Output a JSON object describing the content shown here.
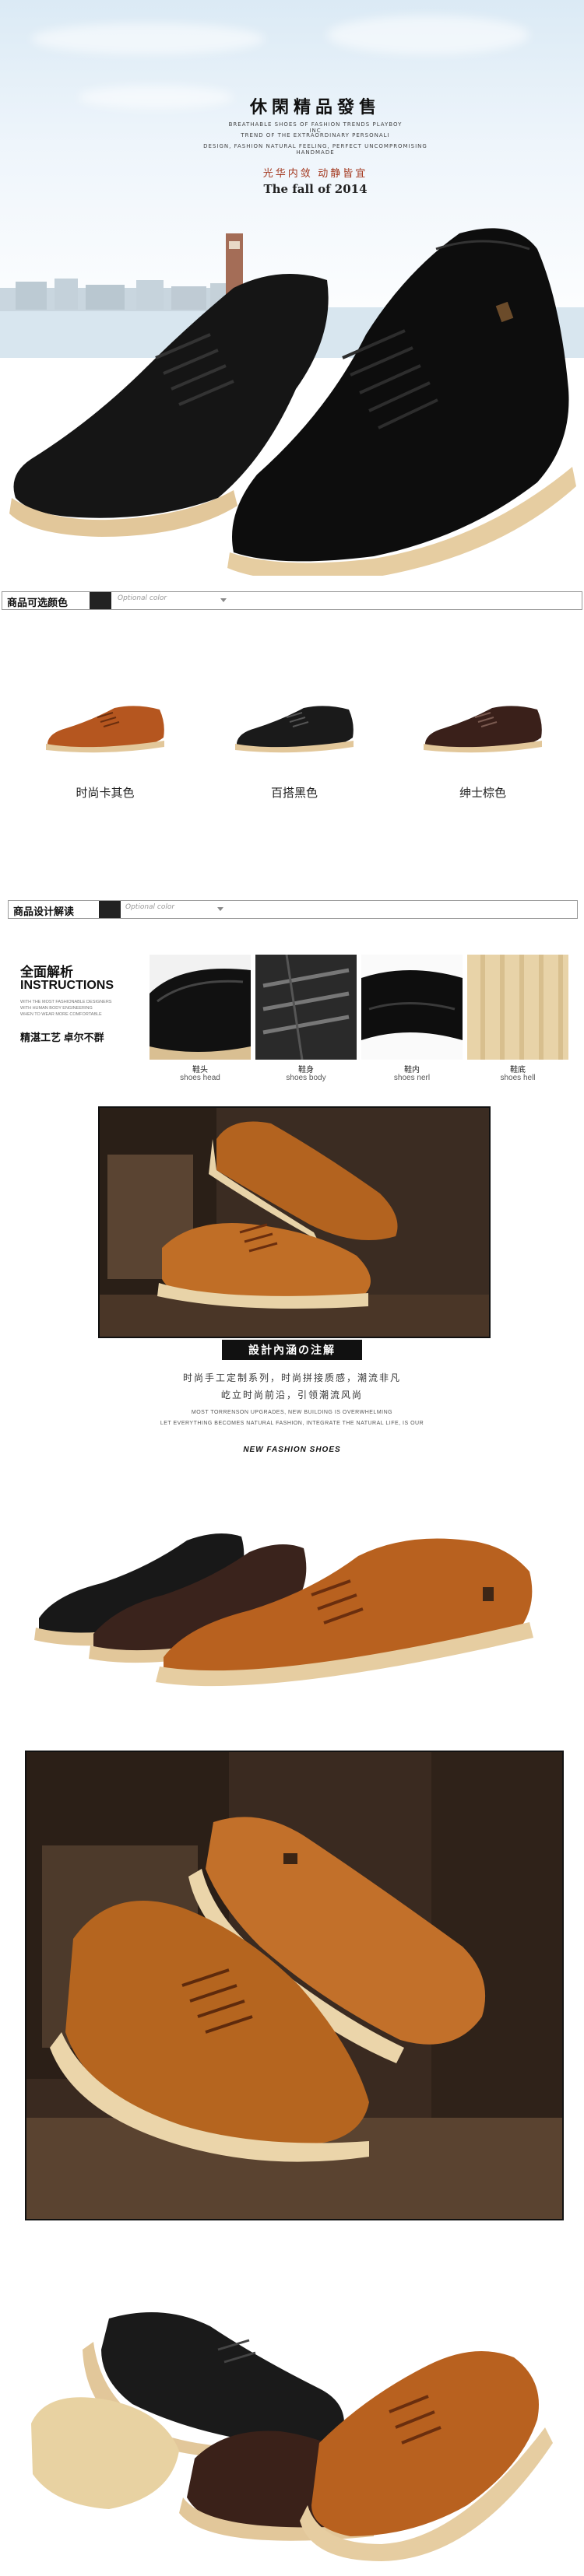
{
  "hero": {
    "title": "休閑精品發售",
    "sub_line1": "BREATHABLE SHOES OF FASHION TRENDS PLAYBOY INC",
    "sub_line2": "TREND OF THE EXTRAORDINARY PERSONALI",
    "sub_line3": "DESIGN, FASHION NATURAL FEELING, PERFECT UNCOMPROMISING HANDMADE",
    "cn_line": "光华内敛    动静皆宜",
    "fall_line": "The fall of 2014"
  },
  "colors_section": {
    "title": "商品可选颜色",
    "tab": "Optional color",
    "options": [
      {
        "label": "时尚卡其色",
        "color": "#b5561f"
      },
      {
        "label": "百搭黑色",
        "color": "#1a1a1a"
      },
      {
        "label": "绅士棕色",
        "color": "#3a201a"
      }
    ]
  },
  "detail_section": {
    "title": "商品设计解读",
    "tab": "Optional color",
    "left_title_cn": "全面解析",
    "left_title_en": "INSTRUCTIONS",
    "left_small1": "WITH THE MOST FASHIONABLE DESIGNERS",
    "left_small2": "WITH HUMAN BODY ENGINEERING",
    "left_small3": "WHEN TO WEAR MORE COMFORTABLE",
    "left_slogan": "精湛工艺 卓尔不群",
    "thumbs": [
      {
        "cn": "鞋头",
        "en": "shoes head"
      },
      {
        "cn": "鞋身",
        "en": "shoes body"
      },
      {
        "cn": "鞋内",
        "en": "shoes nerl"
      },
      {
        "cn": "鞋底",
        "en": "shoes hell"
      }
    ]
  },
  "design_section": {
    "title": "設計內涵の注解",
    "cn_line1": "时尚手工定制系列，时尚拼接质感，潮流非凡",
    "cn_line2": "屹立时尚前沿，引领潮流风尚",
    "en_line1": "MOST TORRENSON UPGRADES, NEW BUILDING IS OVERWHELMING",
    "en_line2": "LET EVERYTHING BECOMES NATURAL FASHION, INTEGRATE THE NATURAL LIFE, IS OUR",
    "new_fashion": "NEW FASHION SHOES"
  }
}
